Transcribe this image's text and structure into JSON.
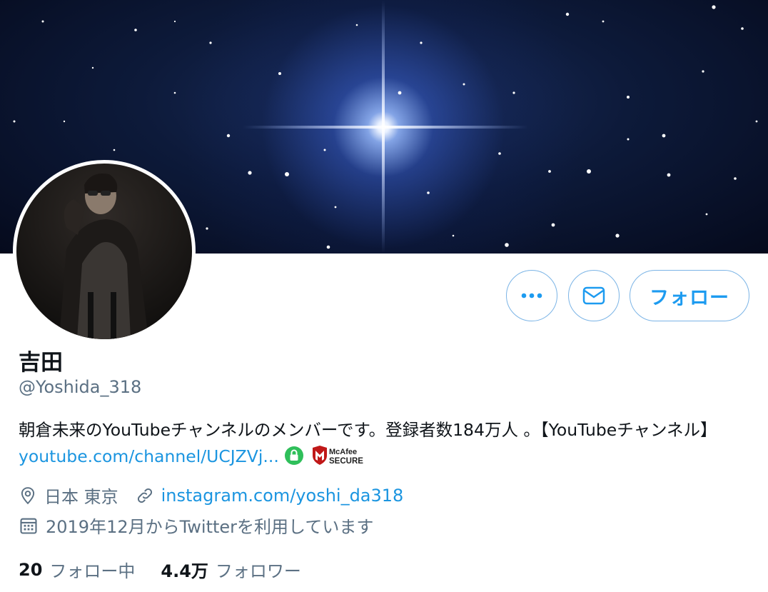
{
  "profile": {
    "display_name": "吉田",
    "handle": "@Yoshida_318",
    "bio_text": "朝倉未来のYouTubeチャンネルのメンバーです。登録者数184万人 。【YouTubeチャンネル】",
    "bio_link": "youtube.com/channel/UCJZVj...",
    "badge_text_1": "McAfee",
    "badge_text_2": "SECURE",
    "location": "日本 東京",
    "website": "instagram.com/yoshi_da318",
    "joined": "2019年12月からTwitterを利用しています",
    "following_count": "20",
    "following_label": "フォロー中",
    "followers_count": "4.4万",
    "followers_label": "フォロワー"
  },
  "actions": {
    "follow_label": "フォロー",
    "more_icon": "more-dots-icon",
    "message_icon": "envelope-icon"
  },
  "icons": {
    "location": "location-pin-icon",
    "link": "link-icon",
    "calendar": "calendar-icon",
    "secure_lock": "lock-icon"
  },
  "colors": {
    "accent": "#1d9bf0",
    "link": "#1b95e0",
    "secondary_text": "#5b7083",
    "button_border": "#7bb4e6"
  }
}
